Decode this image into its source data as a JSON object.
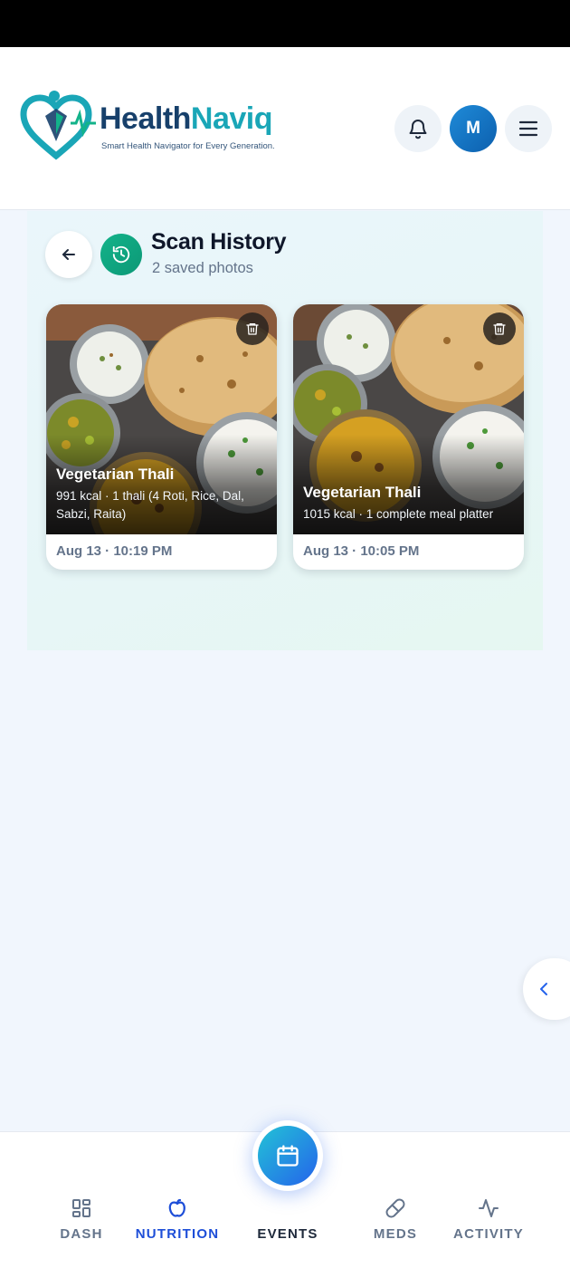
{
  "app": {
    "brand_part1": "Health",
    "brand_part2": "Naviq",
    "tagline": "Smart Health Navigator for Every Generation.",
    "avatar_initial": "M",
    "brand_colors": {
      "navy": "#17406b",
      "teal": "#1aa6b7",
      "green": "#13b38a"
    }
  },
  "header": {
    "icons": [
      "bell-icon",
      "menu-icon"
    ]
  },
  "page": {
    "title": "Scan History",
    "subtitle": "2 saved photos",
    "back_icon": "arrow-left-icon",
    "history_icon": "history-icon"
  },
  "scans": [
    {
      "title": "Vegetarian Thali",
      "description": "991 kcal · 1 thali (4 Roti, Rice, Dal, Sabzi, Raita)",
      "date": "Aug 13 · 10:19 PM"
    },
    {
      "title": "Vegetarian Thali",
      "description": "1015 kcal · 1 complete meal platter",
      "date": "Aug 13 · 10:05 PM"
    }
  ],
  "nav": {
    "items": [
      {
        "label": "DASH",
        "icon": "grid-icon"
      },
      {
        "label": "NUTRITION",
        "icon": "apple-icon",
        "active": true
      },
      {
        "label": "EVENTS",
        "icon": "calendar-icon"
      },
      {
        "label": "MEDS",
        "icon": "pill-icon"
      },
      {
        "label": "ACTIVITY",
        "icon": "activity-icon"
      }
    ]
  }
}
